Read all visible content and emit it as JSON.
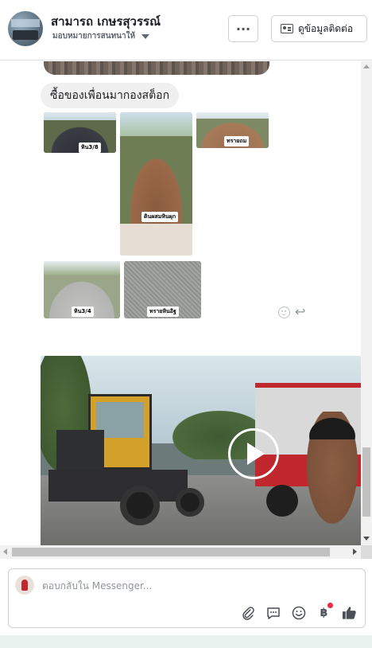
{
  "header": {
    "page_name": "สามารถ เกษรสุวรรณ์",
    "assignee_label": "มอบหมายการสนทนาให้",
    "more_label": "···",
    "contact_label": "ดูข้อมูลติดต่อ"
  },
  "conversation": {
    "message_text": "ซื้อของเพื่อนมากองสต็อก",
    "photos": [
      {
        "caption": "หิน3/8",
        "icon": "photo"
      },
      {
        "caption": "ดินผสมหินผุก",
        "icon": "photo"
      },
      {
        "caption": "ทรายถม",
        "icon": "photo"
      },
      {
        "caption": "หิน3/4",
        "icon": "photo"
      },
      {
        "caption": "ทรายหินอิฐ",
        "icon": "photo"
      }
    ],
    "video": {
      "icon": "play-icon"
    },
    "reaction_icons": [
      "smile-icon",
      "reply-icon"
    ]
  },
  "composer": {
    "placeholder": "ตอบกลับใน Messenger...",
    "tool_icons": [
      "attachment-icon",
      "saved-reply-icon",
      "emoji-icon",
      "payment-icon",
      "like-icon"
    ],
    "baht_symbol": "฿"
  },
  "colors": {
    "notification_dot": "#f02849",
    "play_overlay": "#ffffff"
  }
}
